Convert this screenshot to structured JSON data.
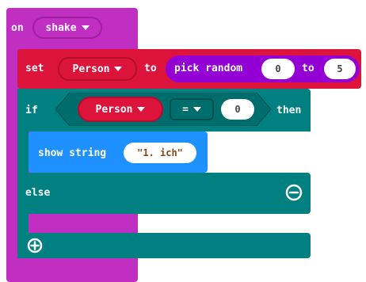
{
  "colors": {
    "event": "#c12fc2",
    "event_dark": "#a01fa1",
    "variable": "#dc143c",
    "variable_dark": "#b00f30",
    "math": "#9400d3",
    "logic": "#008080",
    "logic_inset": "#006d6d",
    "basic": "#1e90ff",
    "text_dark": "#444444"
  },
  "event_block": {
    "keyword": "on",
    "gesture": "shake"
  },
  "set_block": {
    "keyword": "set",
    "variable": "Person",
    "to": "to",
    "random_label": "pick random",
    "min": "0",
    "to2": "to",
    "max": "5"
  },
  "if_block": {
    "keyword": "if",
    "variable": "Person",
    "operator": "=",
    "value": "0",
    "then": "then",
    "else": "else"
  },
  "show_block": {
    "label": "show string",
    "value": "\"1. ich\""
  },
  "icons": {
    "remove": "minus-circle-icon",
    "add": "plus-circle-icon",
    "dropdown": "caret-down-icon"
  }
}
